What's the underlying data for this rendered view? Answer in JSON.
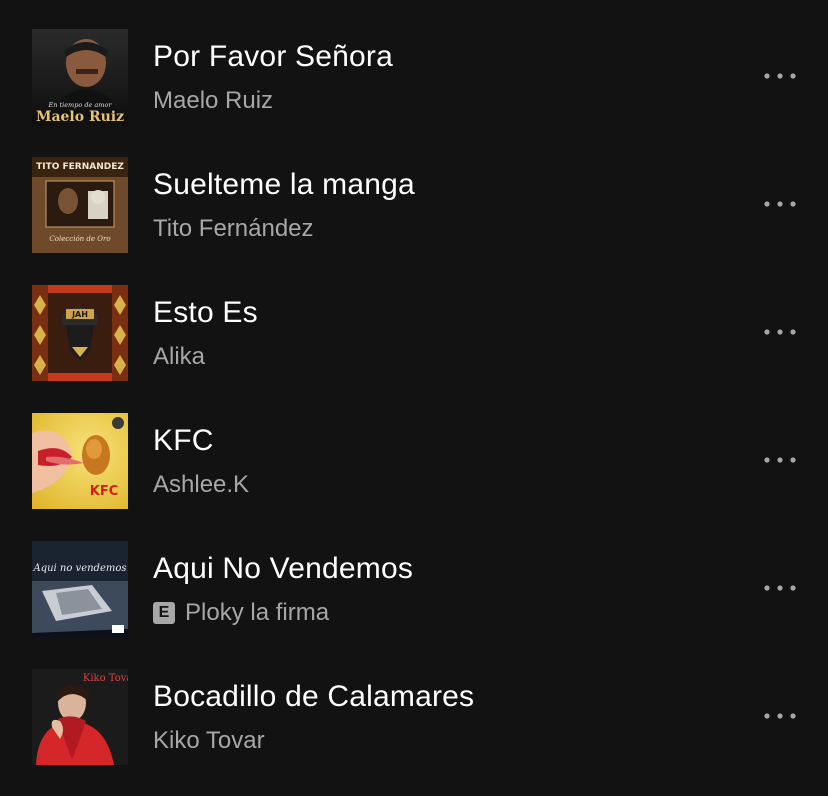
{
  "tracks": [
    {
      "title": "Por Favor Señora",
      "artist": "Maelo Ruiz",
      "explicit": false,
      "cover_text": "Maelo Ruiz",
      "cover_subtext": "En tiempo de amor"
    },
    {
      "title": "Suelteme la manga",
      "artist": "Tito Fernández",
      "explicit": false,
      "cover_text": "TITO FERNANDEZ",
      "cover_subtext": "Colección de Oro"
    },
    {
      "title": "Esto Es",
      "artist": "Alika",
      "explicit": false,
      "cover_text": "JAH"
    },
    {
      "title": "KFC",
      "artist": "Ashlee.K",
      "explicit": false,
      "cover_text": "KFC"
    },
    {
      "title": "Aqui No Vendemos",
      "artist": "Ploky la firma",
      "explicit": true,
      "explicit_label": "E",
      "cover_text": "Aqui no vendemos"
    },
    {
      "title": "Bocadillo de Calamares",
      "artist": "Kiko Tovar",
      "explicit": false,
      "cover_text": "Kiko Tovar"
    }
  ],
  "icons": {
    "more": "more-options-icon"
  },
  "colors": {
    "background": "#121212",
    "title": "#ffffff",
    "subtitle": "#a7a7a7"
  }
}
